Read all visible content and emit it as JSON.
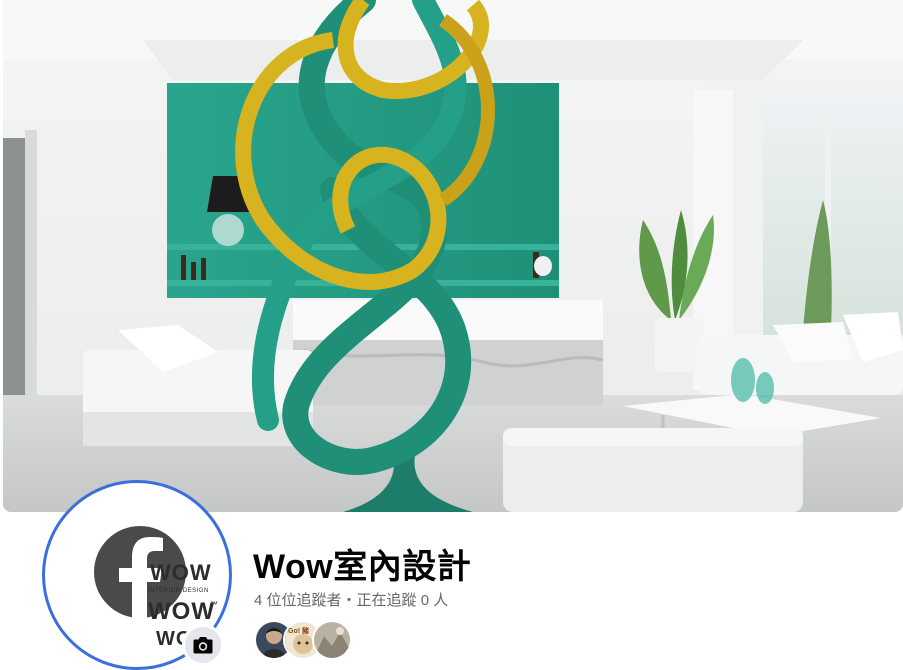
{
  "page": {
    "name": "Wow室內設計",
    "followers": {
      "count": "4",
      "followers_label": "位位追蹤者",
      "separator": "・",
      "following_label": "正在追蹤",
      "following_count": "0",
      "following_unit": "人"
    }
  },
  "profile": {
    "logo": {
      "brand_text": "WOW",
      "sub_text": "INTERIOR DESIGN",
      "tm": "™"
    },
    "ring_color": "#3b6fe0"
  },
  "follower_avatars": [
    {
      "name": "follower-avatar-1"
    },
    {
      "name": "follower-avatar-2",
      "text": "Go! 豬"
    },
    {
      "name": "follower-avatar-3"
    }
  ],
  "icons": {
    "camera": "camera-icon",
    "facebook": "facebook-logo-icon"
  },
  "colors": {
    "accent_teal": "#1f9e86",
    "gold": "#d8b320",
    "text_primary": "#050505",
    "text_secondary": "#65676b"
  }
}
